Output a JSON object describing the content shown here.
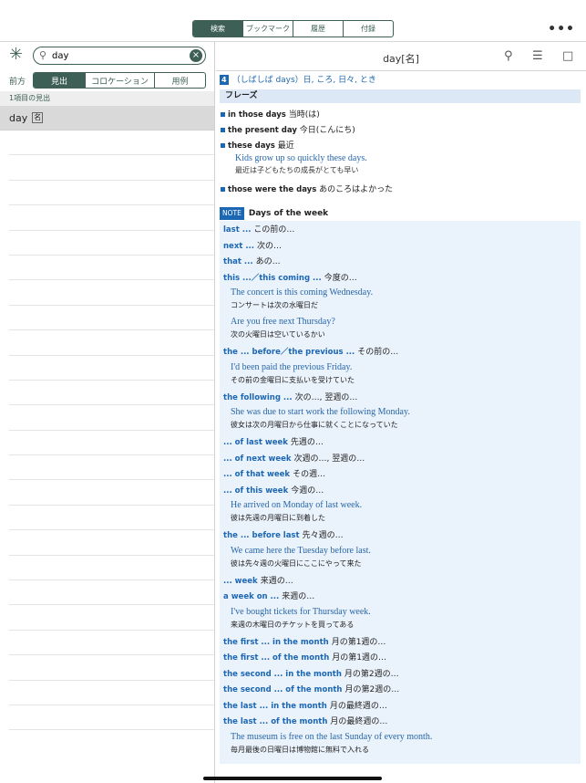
{
  "tabs": [
    "検索",
    "ブックマーク",
    "履歴",
    "付録"
  ],
  "more_label": "•••",
  "search": {
    "value": "day",
    "clear": "×"
  },
  "mode": {
    "label": "前方",
    "options": [
      "見出",
      "コロケーション",
      "用例"
    ]
  },
  "result_count": "1項目の見出",
  "results": [
    {
      "word": "day",
      "pos": "名"
    }
  ],
  "entry_title": "day[名]",
  "sense": {
    "num": "4",
    "text": "（しばしば days）日, ころ, 日々, とき"
  },
  "phrase_header": "フレーズ",
  "phrases": [
    {
      "en": "in those days",
      "jp": "当時(は)"
    },
    {
      "en": "the present day",
      "jp": "今日(こんにち)"
    },
    {
      "en": "these days",
      "jp": "最近",
      "ex_en": "Kids grow up so quickly these days.",
      "ex_jp": "最近は子どもたちの成長がとても早い"
    },
    {
      "en": "those were the days",
      "jp": "あのころはよかった"
    }
  ],
  "note": {
    "tag": "NOTE",
    "title": "Days of the week"
  },
  "note_items": [
    {
      "k": "last ...",
      "jp": "この前の…"
    },
    {
      "k": "next ...",
      "jp": "次の…"
    },
    {
      "k": "that ...",
      "jp": "あの…"
    },
    {
      "k": "this ...／this coming ...",
      "jp": "今度の…",
      "ex": [
        {
          "en": "The concert is this coming Wednesday.",
          "jp": "コンサートは次の水曜日だ"
        },
        {
          "en": "Are you free next Thursday?",
          "jp": "次の火曜日は空いているかい"
        }
      ]
    },
    {
      "k": "the ... before／the previous ...",
      "jp": "その前の…",
      "ex": [
        {
          "en": "I'd been paid the previous Friday.",
          "jp": "その前の金曜日に支払いを受けていた"
        }
      ]
    },
    {
      "k": "the following ...",
      "jp": "次の…, 翌週の…",
      "ex": [
        {
          "en": "She was due to start work the following Monday.",
          "jp": "彼女は次の月曜日から仕事に就くことになっていた"
        }
      ]
    },
    {
      "k": "... of last week",
      "jp": "先週の…"
    },
    {
      "k": "... of next week",
      "jp": "次週の…, 翌週の…"
    },
    {
      "k": "... of that week",
      "jp": "その週…"
    },
    {
      "k": "... of this week",
      "jp": "今週の…",
      "ex": [
        {
          "en": "He arrived on Monday of last week.",
          "jp": "彼は先週の月曜日に到着した"
        }
      ]
    },
    {
      "k": "the ... before last",
      "jp": "先々週の…",
      "ex": [
        {
          "en": "We came here the Tuesday before last.",
          "jp": "彼は先々週の火曜日にここにやって来た"
        }
      ]
    },
    {
      "k": "... week",
      "jp": "来週の…"
    },
    {
      "k": "a week on ...",
      "jp": "来週の…",
      "ex": [
        {
          "en": "I've bought tickets for Thursday week.",
          "jp": "来週の木曜日のチケットを買ってある"
        }
      ]
    },
    {
      "k": "the first ... in the month",
      "jp": "月の第1週の…"
    },
    {
      "k": "the first ... of the month",
      "jp": "月の第1週の…"
    },
    {
      "k": "the second ... in the month",
      "jp": "月の第2週の…"
    },
    {
      "k": "the second ... of the month",
      "jp": "月の第2週の…"
    },
    {
      "k": "the last ... in the month",
      "jp": "月の最終週の…"
    },
    {
      "k": "the last ... of the month",
      "jp": "月の最終週の…",
      "ex": [
        {
          "en": "The museum is free on the last Sunday of every month.",
          "jp": "毎月最後の日曜日は博物館に無料で入れる"
        }
      ]
    }
  ],
  "colors": {
    "accent": "#3d5f55",
    "blue": "#1c67b3"
  }
}
